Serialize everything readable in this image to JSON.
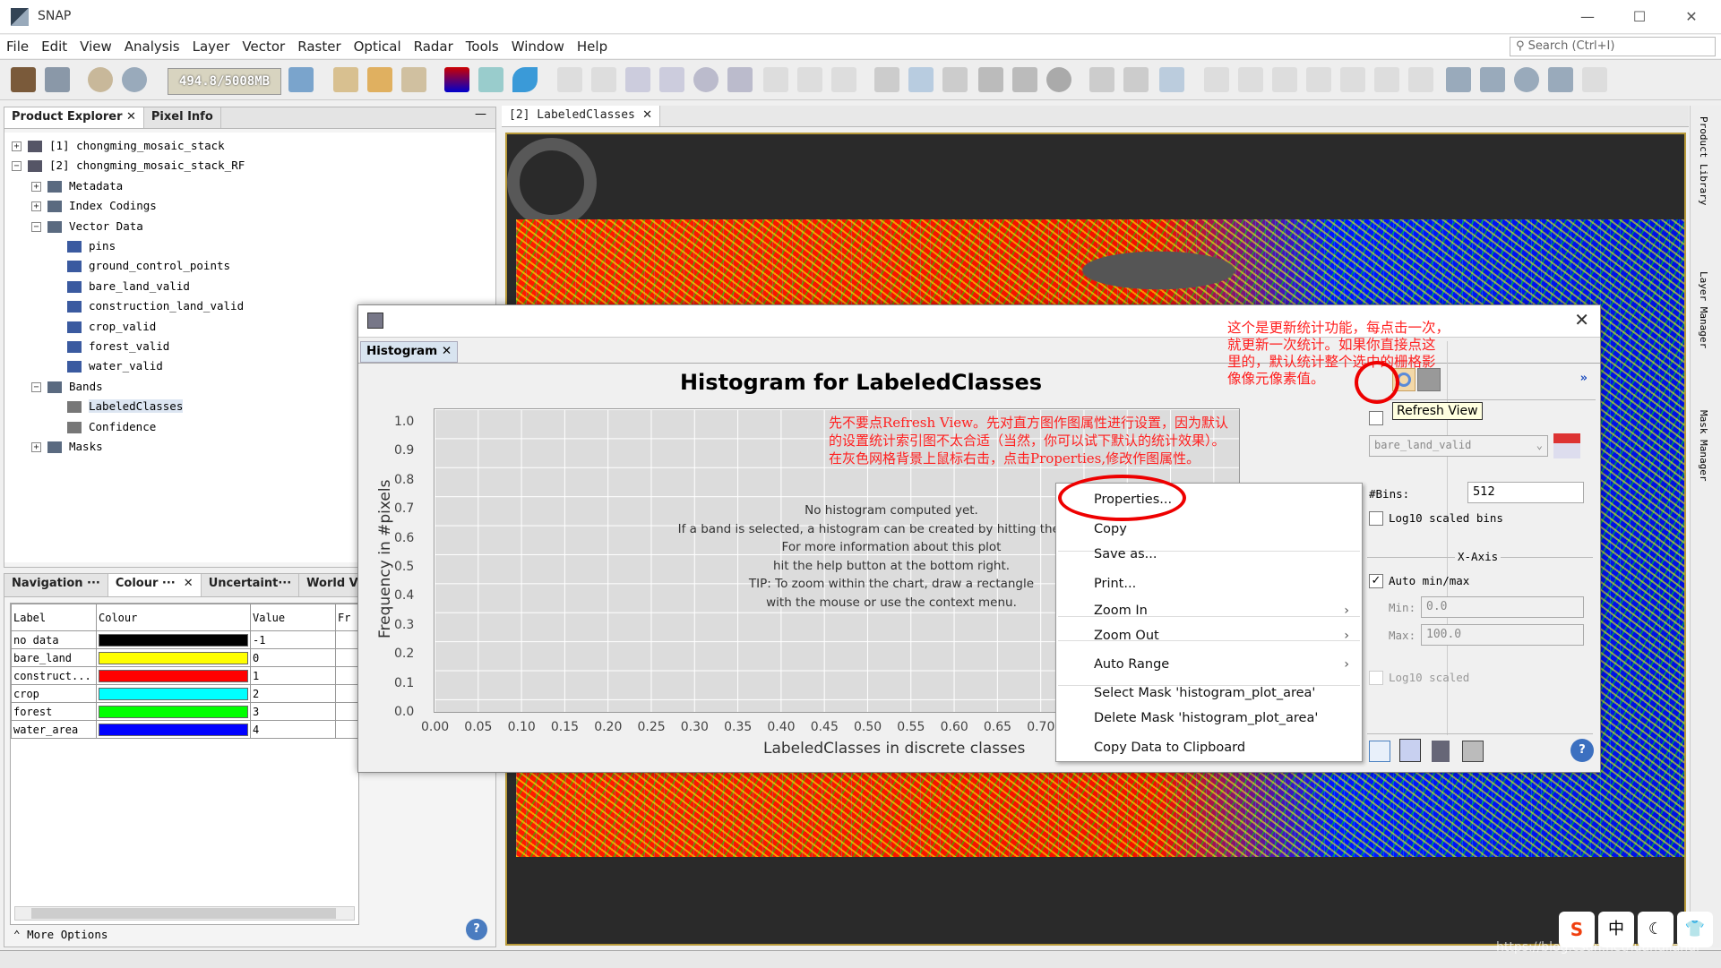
{
  "app": {
    "title": "SNAP"
  },
  "menu": [
    "File",
    "Edit",
    "View",
    "Analysis",
    "Layer",
    "Vector",
    "Raster",
    "Optical",
    "Radar",
    "Tools",
    "Window",
    "Help"
  ],
  "search": {
    "placeholder": "Search (Ctrl+I)"
  },
  "toolbar": {
    "memory": "494.8/5008MB"
  },
  "product_explorer": {
    "tabs": [
      "Product Explorer",
      "Pixel Info"
    ],
    "tree": [
      {
        "label": "[1]  chongming_mosaic_stack",
        "level": 0,
        "type": "product",
        "expander": "+"
      },
      {
        "label": "[2]  chongming_mosaic_stack_RF",
        "level": 0,
        "type": "product",
        "expander": "-"
      },
      {
        "label": "Metadata",
        "level": 1,
        "type": "folder",
        "expander": "+"
      },
      {
        "label": "Index Codings",
        "level": 1,
        "type": "folder",
        "expander": "+"
      },
      {
        "label": "Vector Data",
        "level": 1,
        "type": "folder",
        "expander": "-"
      },
      {
        "label": "pins",
        "level": 2,
        "type": "vector"
      },
      {
        "label": "ground_control_points",
        "level": 2,
        "type": "vector"
      },
      {
        "label": "bare_land_valid",
        "level": 2,
        "type": "vector"
      },
      {
        "label": "construction_land_valid",
        "level": 2,
        "type": "vector"
      },
      {
        "label": "crop_valid",
        "level": 2,
        "type": "vector"
      },
      {
        "label": "forest_valid",
        "level": 2,
        "type": "vector"
      },
      {
        "label": "water_valid",
        "level": 2,
        "type": "vector"
      },
      {
        "label": "Bands",
        "level": 1,
        "type": "folder",
        "expander": "-"
      },
      {
        "label": "LabeledClasses",
        "level": 2,
        "type": "band",
        "selected": true
      },
      {
        "label": "Confidence",
        "level": 2,
        "type": "band"
      },
      {
        "label": "Masks",
        "level": 1,
        "type": "folder",
        "expander": "+"
      }
    ]
  },
  "colour_panel": {
    "tabs": [
      "Navigation ···",
      "Colour ···",
      "Uncertaint···",
      "World View"
    ],
    "headers": [
      "Label",
      "Colour",
      "Value",
      "Fr"
    ],
    "rows": [
      {
        "label": "no data",
        "colour": "#000000",
        "value": "-1"
      },
      {
        "label": "bare_land",
        "colour": "#ffff00",
        "value": "0"
      },
      {
        "label": "construct...",
        "colour": "#ff0000",
        "value": "1"
      },
      {
        "label": "crop",
        "colour": "#00ffff",
        "value": "2"
      },
      {
        "label": "forest",
        "colour": "#00ff00",
        "value": "3"
      },
      {
        "label": "water_area",
        "colour": "#0000ff",
        "value": "4"
      }
    ],
    "more_options": "More Options"
  },
  "image_view": {
    "tab": "[2] LabeledClasses"
  },
  "right_sidebar": [
    "Product Library",
    "Layer Manager",
    "Mask Manager"
  ],
  "histogram": {
    "tab": "Histogram",
    "title": "Histogram for LabeledClasses",
    "ylabel": "Frequency in #pixels",
    "xlabel": "LabeledClasses in discrete classes",
    "yticks": [
      "0.0",
      "0.1",
      "0.2",
      "0.3",
      "0.4",
      "0.5",
      "0.6",
      "0.7",
      "0.8",
      "0.9",
      "1.0"
    ],
    "xticks": [
      "0.00",
      "0.05",
      "0.10",
      "0.15",
      "0.20",
      "0.25",
      "0.30",
      "0.35",
      "0.40",
      "0.45",
      "0.50",
      "0.55",
      "0.60",
      "0.65",
      "0.70"
    ],
    "message": [
      "No histogram computed yet.",
      "If a band is selected, a histogram can be created by hitting the 'Refres",
      "For more information about this plot",
      "hit the help button at the bottom right.",
      "TIP: To zoom within the chart, draw a rectangle",
      "with the mouse or use the context menu."
    ]
  },
  "context_menu": [
    {
      "label": "Properties..."
    },
    {
      "label": "Copy"
    },
    {
      "label": "Save as..."
    },
    {
      "label": "Print..."
    },
    {
      "label": "Zoom In",
      "submenu": true
    },
    {
      "label": "Zoom Out",
      "submenu": true
    },
    {
      "label": "Auto Range",
      "submenu": true
    },
    {
      "label": "Select Mask 'histogram_plot_area'"
    },
    {
      "label": "Delete Mask 'histogram_plot_area'"
    },
    {
      "label": "Copy Data to Clipboard"
    }
  ],
  "options": {
    "tooltip": "Refresh View",
    "mask_select": "bare_land_valid",
    "bins_label": "#Bins:",
    "bins": "512",
    "log_bins": "Log10 scaled bins",
    "xaxis": "X-Axis",
    "auto_minmax": "Auto min/max",
    "auto_checked": true,
    "min_label": "Min:",
    "min": "0.0",
    "max_label": "Max:",
    "max": "100.0",
    "log_scaled": "Log10 scaled"
  },
  "annotations": {
    "note_top": [
      "这个是更新统计功能，每点击一次，",
      "就更新一次统计。如果你直接点这",
      "里的，默认统计整个选中的栅格影",
      "像像元像素值。"
    ],
    "note_mid": [
      "先不要点Refresh View。先对直方图作图属性进行设置，因为默认",
      "的设置统计索引图不太合适（当然，你可以试下默认的统计效果）。",
      "在灰色网格背景上鼠标右击，点击Properties,修改作图属性。"
    ],
    "color": "#ff2020"
  },
  "watermark": "https://blog.csdn.net/luanuilanui"
}
